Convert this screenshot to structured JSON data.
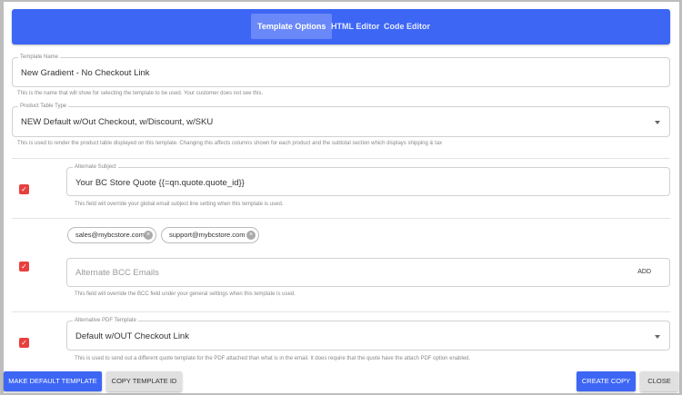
{
  "tabs": [
    {
      "label": "Template Options"
    },
    {
      "label": "HTML Editor"
    },
    {
      "label": "Code Editor"
    }
  ],
  "template_name": {
    "label": "Template Name",
    "value": "New Gradient - No Checkout Link",
    "help": "This is the name that will show for selecting the template to be used. Your customer does not see this."
  },
  "product_table": {
    "label": "Product Table Type",
    "value": "NEW Default w/Out Checkout, w/Discount, w/SKU",
    "help": "This is used to render the product table displayed on this template. Changing this affects columns shown for each product and the subtotal section which displays shipping & tax"
  },
  "alt_subject": {
    "checked": true,
    "label": "Alternate Subject",
    "value": "Your BC Store Quote {{=qn.quote.quote_id}}",
    "help": "This field will override your global email subject line setting when this template is used."
  },
  "bcc": {
    "checked": true,
    "chips": [
      "sales@mybcstore.com",
      "support@mybcstore.com"
    ],
    "placeholder": "Alternate BCC Emails",
    "add_label": "ADD",
    "help": "This field will override the BCC field under your general settings when this template is used."
  },
  "alt_pdf": {
    "checked": true,
    "label": "Alternative PDF Template",
    "value": "Default w/OUT Checkout Link",
    "help": "This is used to send out a different quote template for the PDF attached than what is in the email. It does require that the quote have the attach PDF option enabled."
  },
  "buttons": {
    "make_default": "MAKE DEFAULT TEMPLATE",
    "copy_id": "COPY TEMPLATE ID",
    "create_copy": "CREATE COPY",
    "close": "CLOSE"
  },
  "colors": {
    "accent": "#3d66f5",
    "checkbox": "#e8403f"
  }
}
